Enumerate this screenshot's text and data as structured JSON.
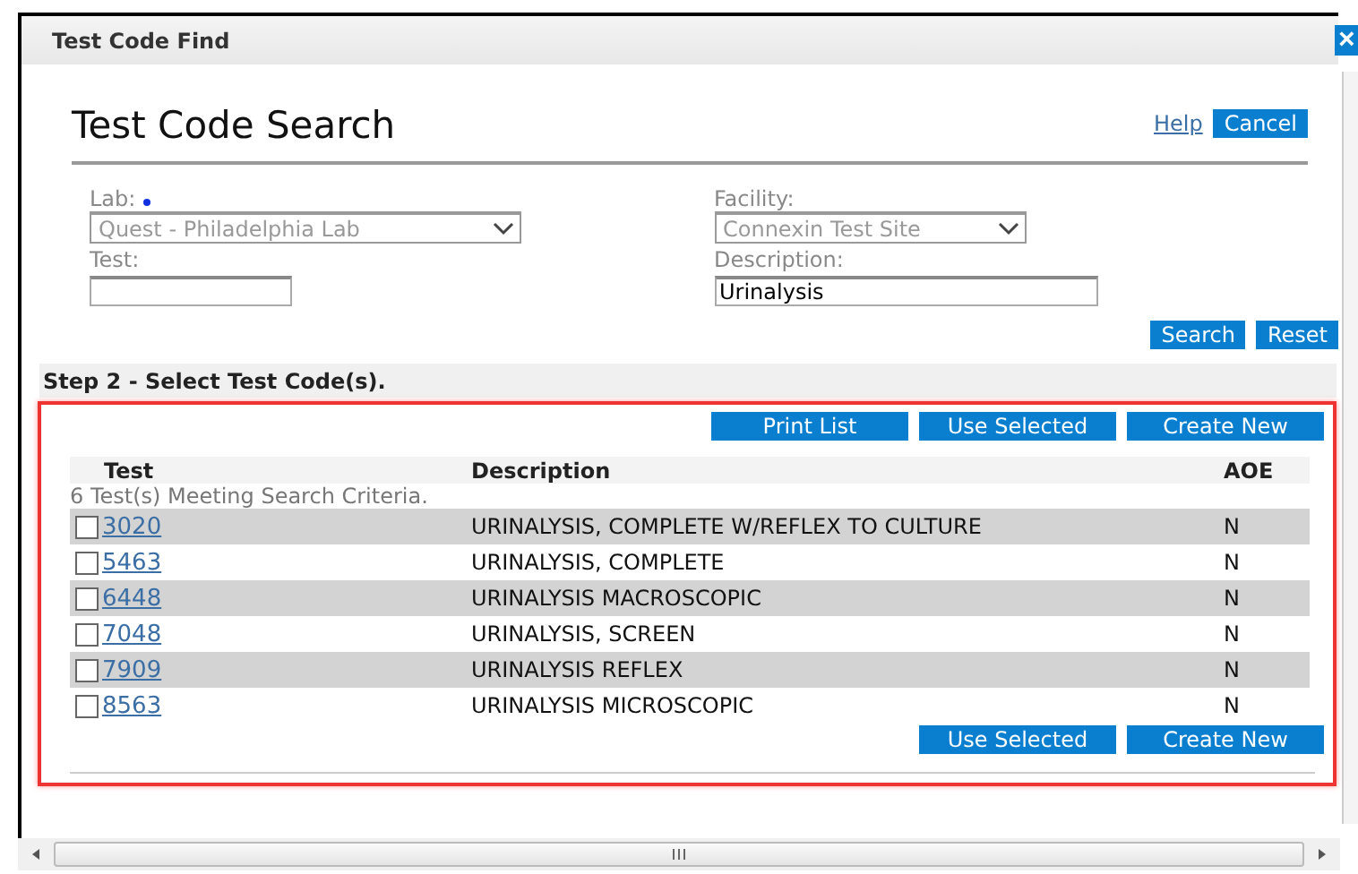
{
  "window": {
    "title": "Test Code Find",
    "close": "×"
  },
  "heading": "Test Code Search",
  "links": {
    "help": "Help",
    "cancel": "Cancel"
  },
  "form": {
    "lab": {
      "label": "Lab:",
      "required": true,
      "value": "Quest - Philadelphia Lab",
      "disabled": true
    },
    "facility": {
      "label": "Facility:",
      "value": "Connexin Test Site",
      "disabled": true
    },
    "test": {
      "label": "Test:"
    },
    "description": {
      "label": "Description:",
      "value": "Urinalysis"
    }
  },
  "form_buttons": [
    "Search",
    "Reset"
  ],
  "step": "Step 2 - Select Test Code(s).",
  "top_buttons": [
    "Print List",
    "Use Selected",
    "Create New"
  ],
  "table": {
    "columns": [
      "Test",
      "Description",
      "AOE"
    ],
    "summary": "6 Test(s) Meeting Search Criteria.",
    "rows": [
      {
        "code": "3020",
        "description": "URINALYSIS, COMPLETE W/REFLEX TO CULTURE",
        "aoe": "N",
        "checked": false
      },
      {
        "code": "5463",
        "description": "URINALYSIS, COMPLETE",
        "aoe": "N",
        "checked": false
      },
      {
        "code": "6448",
        "description": "URINALYSIS MACROSCOPIC",
        "aoe": "N",
        "checked": false
      },
      {
        "code": "7048",
        "description": "URINALYSIS, SCREEN",
        "aoe": "N",
        "checked": false
      },
      {
        "code": "7909",
        "description": "URINALYSIS REFLEX",
        "aoe": "N",
        "checked": false
      },
      {
        "code": "8563",
        "description": "URINALYSIS MICROSCOPIC",
        "aoe": "N",
        "checked": false
      }
    ]
  },
  "bottom_buttons": [
    "Use Selected",
    "Create New"
  ]
}
